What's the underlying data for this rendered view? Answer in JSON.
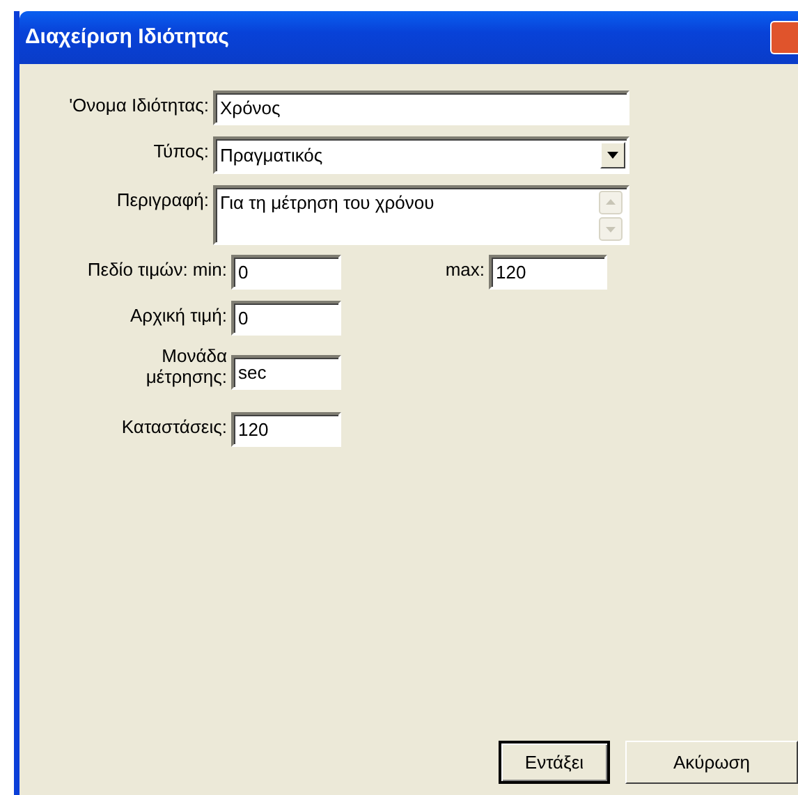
{
  "window": {
    "title": "Διαχείριση Ιδιότητας"
  },
  "fields": [
    {
      "kind": "text",
      "label": "'Ονομα Ιδιότητας:",
      "value": "Χρόνος"
    },
    {
      "kind": "select",
      "label": "Τύπος:",
      "value": "Πραγματικός"
    },
    {
      "kind": "textarea",
      "label": "Περιγραφή:",
      "value": "Για τη μέτρηση του χρόνου"
    },
    {
      "kind": "range",
      "label": "Πεδίο τιμών: min:",
      "value": "0",
      "max_label": "max:",
      "max_value": "120"
    },
    {
      "kind": "short",
      "label": "Αρχική τιμή:",
      "value": "0"
    },
    {
      "kind": "short",
      "label": "Μονάδα μέτρησης:",
      "value": "sec"
    },
    {
      "kind": "short",
      "label": "Καταστάσεις:",
      "value": "120"
    }
  ],
  "buttons": [
    {
      "label": "Εντάξει",
      "default": true
    },
    {
      "label": "Ακύρωση",
      "default": false
    }
  ]
}
